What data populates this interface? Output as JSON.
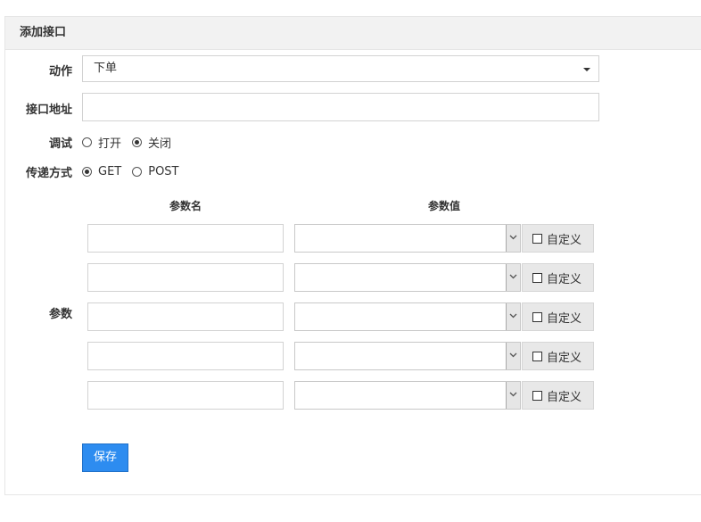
{
  "panel": {
    "title": "添加接口"
  },
  "form": {
    "action": {
      "label": "动作",
      "value": "下单"
    },
    "url": {
      "label": "接口地址",
      "value": ""
    },
    "debug": {
      "label": "调试",
      "options": [
        {
          "label": "打开",
          "checked": false
        },
        {
          "label": "关闭",
          "checked": true
        }
      ]
    },
    "method": {
      "label": "传递方式",
      "options": [
        {
          "label": "GET",
          "checked": true
        },
        {
          "label": "POST",
          "checked": false
        }
      ]
    },
    "params": {
      "label": "参数",
      "name_header": "参数名",
      "value_header": "参数值",
      "custom_label": "自定义",
      "rows": [
        {
          "name": "",
          "value": "",
          "custom": false
        },
        {
          "name": "",
          "value": "",
          "custom": false
        },
        {
          "name": "",
          "value": "",
          "custom": false
        },
        {
          "name": "",
          "value": "",
          "custom": false
        },
        {
          "name": "",
          "value": "",
          "custom": false
        }
      ]
    },
    "save_label": "保存"
  },
  "colors": {
    "primary": "#2d8cf0",
    "header_bg": "#f2f2f2",
    "border": "#d2d2d2"
  }
}
